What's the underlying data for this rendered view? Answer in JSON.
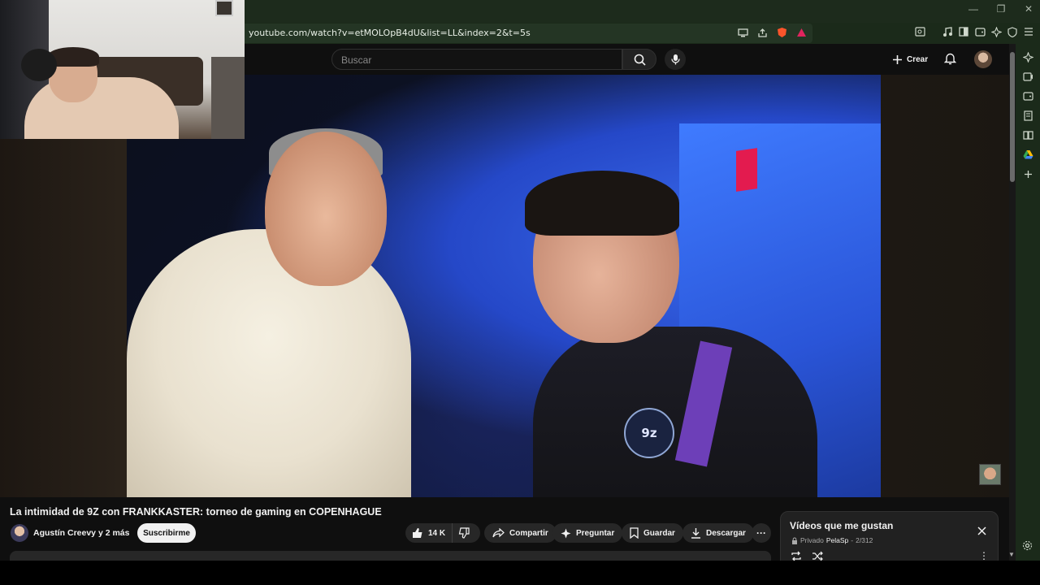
{
  "browser": {
    "url": "youtube.com/watch?v=etMOLOpB4dU&list=LL&index=2&t=5s",
    "window_controls": [
      "—",
      "❐",
      "✕"
    ]
  },
  "header": {
    "search_placeholder": "Buscar",
    "create_label": "Crear"
  },
  "video": {
    "badge_text": "9z",
    "title": "La intimidad de 9Z con FRANKKASTER: torneo de gaming en COPENHAGUE",
    "channel": "Agustín Creevy y 2 más",
    "subscribe_label": "Suscribirme",
    "like_count": "14 K",
    "share_label": "Compartir",
    "ask_label": "Preguntar",
    "save_label": "Guardar",
    "download_label": "Descargar"
  },
  "playlist": {
    "title": "Vídeos que me gustan",
    "privacy": "Privado",
    "owner": "PelaSp",
    "position": "2/312"
  },
  "colors": {
    "background": "#0f0f0f",
    "browser_chrome": "#1b2a1a",
    "pill": "#272727",
    "subscribe": "#f1f1f1"
  }
}
